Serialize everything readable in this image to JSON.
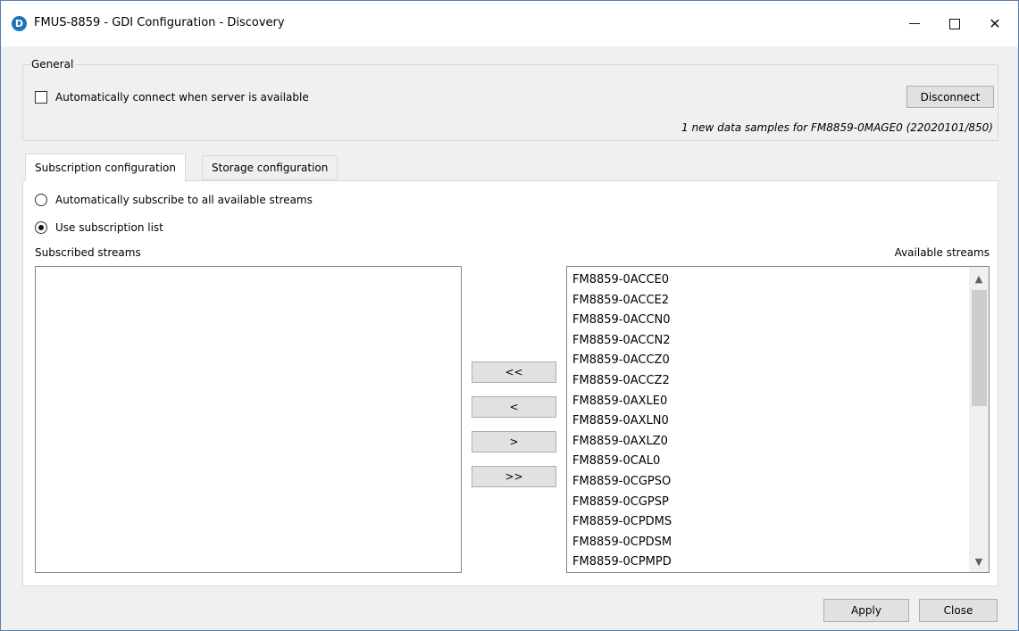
{
  "window": {
    "title": "FMUS-8859 - GDI Configuration - Discovery",
    "icon_letter": "D",
    "minimize_glyph": "",
    "close_glyph": "✕"
  },
  "general": {
    "group_label": "General",
    "auto_connect_label": "Automatically connect when server is available",
    "auto_connect_checked": false,
    "disconnect_label": "Disconnect",
    "status_text": "1 new data samples for FM8859-0MAGE0 (22020101/850)"
  },
  "tabs": [
    {
      "label": "Subscription configuration",
      "active": true
    },
    {
      "label": "Storage configuration",
      "active": false
    }
  ],
  "subscription": {
    "auto_subscribe_label": "Automatically subscribe to all available streams",
    "use_list_label": "Use subscription list",
    "selected_mode": "use_list",
    "subscribed_header": "Subscribed streams",
    "available_header": "Available streams",
    "subscribed_streams": [],
    "available_streams": [
      "FM8859-0ACCE0",
      "FM8859-0ACCE2",
      "FM8859-0ACCN0",
      "FM8859-0ACCN2",
      "FM8859-0ACCZ0",
      "FM8859-0ACCZ2",
      "FM8859-0AXLE0",
      "FM8859-0AXLN0",
      "FM8859-0AXLZ0",
      "FM8859-0CAL0",
      "FM8859-0CGPSO",
      "FM8859-0CGPSP",
      "FM8859-0CPDMS",
      "FM8859-0CPDSM",
      "FM8859-0CPMPD"
    ],
    "move_buttons": {
      "add_all": "<<",
      "add_one": "<",
      "remove_one": ">",
      "remove_all": ">>"
    }
  },
  "footer": {
    "apply_label": "Apply",
    "close_label": "Close"
  }
}
